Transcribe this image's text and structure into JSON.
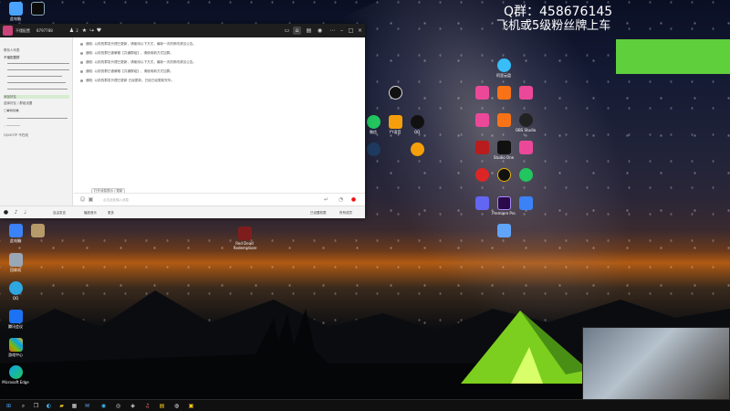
{
  "overlay": {
    "qq_group": "Q群：458676145",
    "slogan": "飞机或5级粉丝牌上车"
  },
  "qq_window": {
    "name": "不懂配置",
    "id": "8797788",
    "member_count": "2",
    "message_lines": [
      "通知: 以前的群发代理已更新，请使用以下方式，最新一次的修改请见公告。",
      "通知: 以前的群已被解散【共通群组】，请使用新方式加群。",
      "通知: 以前的群发代理已更新，请使用以下方式，最新一次的修改请见公告。",
      "通知: 以前的群已被解散【共通群组】，请使用新方式加群。",
      "通知: 以前的群发代理已更新 已经更新，已经已经更新完毕。"
    ],
    "pinned_tag": "打开消息提示 / 更新",
    "input_placeholder": "点击此处输入消息",
    "bottom_items": [
      "自由发言",
      "播放音乐",
      "更多"
    ],
    "bottom_right": [
      "已设置权限",
      "所有成员"
    ],
    "sidebar_rows": [
      "联系人列表",
      "不懂配置群",
      "添加好友",
      "选择好友 / 群组设置",
      "QQGOTP 不在线"
    ]
  },
  "desktop_left_icons": [
    "此电脑",
    "回收站",
    "QQ",
    "腾讯会议",
    "电脑管家",
    "游戏中心",
    "Microsoft Edge"
  ],
  "desktop_icons": [
    "阿里云盘",
    "原神",
    "QQ音乐",
    "网易云音乐",
    "微信",
    "QQ",
    "YY语音",
    "哔哩哔哩",
    "斗鱼直播",
    "虎牙直播",
    "OBS Studio",
    "Studio One",
    "FL Studio",
    "剪映",
    "Premiere Pro",
    "迅雷",
    "WeGame",
    "Steam",
    "Red Dead Redemption",
    "爱奇艺",
    "腾讯视频"
  ],
  "taskbar_icons": [
    "windows-icon",
    "search-icon",
    "task-view-icon",
    "edge-icon",
    "explorer-icon",
    "store-icon",
    "mail-icon",
    "qq-icon",
    "obs-icon",
    "steam-icon",
    "music-icon",
    "folder-icon"
  ],
  "colors": {
    "accent": "#5fcf3c",
    "qq_title": "#1e1e1e",
    "tent": "#b5ff3c"
  }
}
